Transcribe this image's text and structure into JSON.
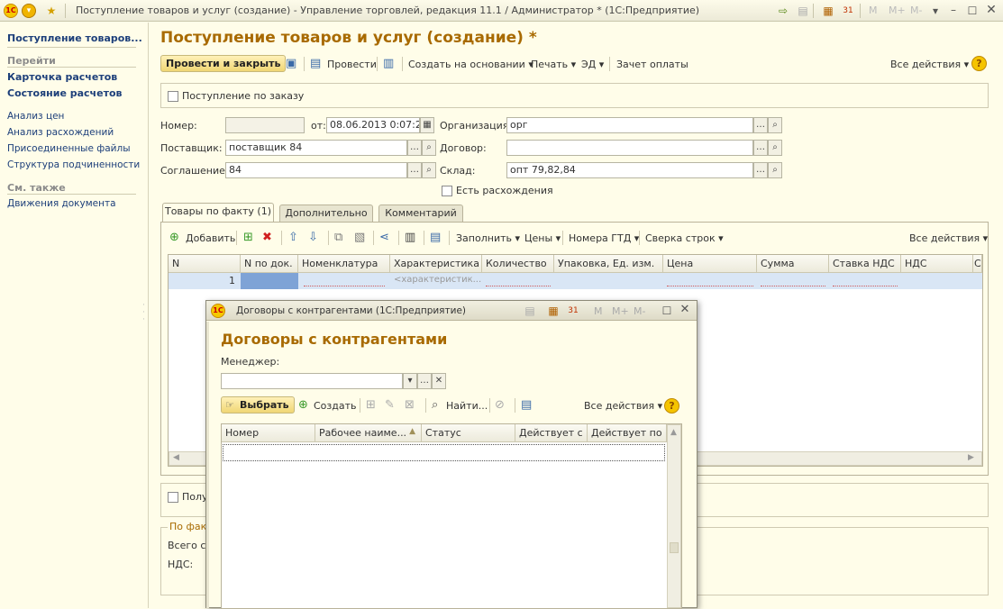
{
  "window": {
    "title": "Поступление товаров и услуг (создание) - Управление торговлей, редакция 11.1 / Администратор * (1С:Предприятие)",
    "logo_text": "1С",
    "buttons": [
      "M",
      "M+",
      "M-"
    ]
  },
  "sidebar": {
    "header": "Поступление товаров...",
    "goto_section": "Перейти",
    "goto_links": [
      "Карточка расчетов",
      "Состояние расчетов"
    ],
    "links": [
      "Анализ цен",
      "Анализ расхождений",
      "Присоединенные файлы",
      "Структура подчиненности"
    ],
    "see_also_section": "См. также",
    "see_also_links": [
      "Движения документа"
    ]
  },
  "form": {
    "title": "Поступление товаров и услуг (создание) *",
    "toolbar": {
      "post_close": "Провести и закрыть",
      "post": "Провести",
      "create_based": "Создать на основании",
      "print": "Печать",
      "ed": "ЭД",
      "payment_offset": "Зачет оплаты",
      "all_actions": "Все действия"
    },
    "by_order_label": "Поступление по заказу",
    "number_label": "Номер:",
    "number_value": "",
    "date_label": "от:",
    "date_value": "08.06.2013  0:07:26",
    "supplier_label": "Поставщик:",
    "supplier_value": "поставщик 84",
    "agreement_label": "Соглашение:",
    "agreement_value": "84",
    "organization_label": "Организация:",
    "organization_value": "орг",
    "contract_label": "Договор:",
    "contract_value": "",
    "warehouse_label": "Склад:",
    "warehouse_value": "опт 79,82,84",
    "discrepancy_label": "Есть расхождения",
    "tabs": [
      "Товары по факту (1)",
      "Дополнительно",
      "Комментарий"
    ],
    "goods_toolbar": {
      "add": "Добавить",
      "fill": "Заполнить",
      "prices": "Цены",
      "gtd": "Номера ГТД",
      "reconcile": "Сверка строк",
      "all_actions": "Все действия"
    },
    "table": {
      "headers": [
        "N",
        "N по док.",
        "Номенклатура",
        "Характеристика",
        "Количество",
        "Упаковка, Ед. изм.",
        "Цена",
        "Сумма",
        "Ставка НДС",
        "НДС",
        "С"
      ],
      "row": {
        "n": "1",
        "characteristic_placeholder": "<характеристик..."
      }
    },
    "bottom_check_label": "Полу",
    "by_fact_section": "По факт",
    "total_label": "Всего с",
    "vat_label": "НДС:"
  },
  "dialog": {
    "title": "Договоры с контрагентами  (1С:Предприятие)",
    "heading": "Договоры с контрагентами",
    "manager_label": "Менеджер:",
    "manager_value": "",
    "select_button": "Выбрать",
    "create_button": "Создать",
    "find_button": "Найти...",
    "all_actions": "Все действия",
    "table_headers": [
      "Номер",
      "Рабочее наиме...",
      "Статус",
      "Действует с",
      "Действует по"
    ],
    "buttons": [
      "M",
      "M+",
      "M-"
    ]
  },
  "colors": {
    "title": "#a86a00",
    "link": "#1d3f7a",
    "background": "#fffde9",
    "selection": "#d9e6f5"
  }
}
